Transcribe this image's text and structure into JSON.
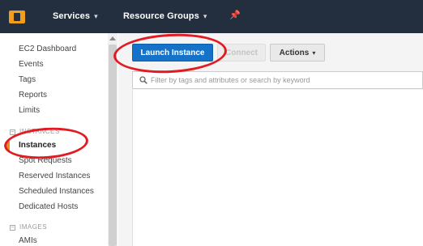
{
  "topnav": {
    "services_label": "Services",
    "resource_groups_label": "Resource Groups",
    "pin_icon": "pin-icon",
    "bg_color": "#232f3e",
    "logo_color": "#f29d1b"
  },
  "sidebar": {
    "items_top": [
      {
        "label": "EC2 Dashboard"
      },
      {
        "label": "Events"
      },
      {
        "label": "Tags"
      },
      {
        "label": "Reports"
      },
      {
        "label": "Limits"
      }
    ],
    "sections": [
      {
        "title": "INSTANCES",
        "items": [
          {
            "label": "Instances",
            "active": true
          },
          {
            "label": "Spot Requests"
          },
          {
            "label": "Reserved Instances"
          },
          {
            "label": "Scheduled Instances"
          },
          {
            "label": "Dedicated Hosts"
          }
        ]
      },
      {
        "title": "IMAGES",
        "items": [
          {
            "label": "AMIs"
          }
        ]
      }
    ],
    "active_color": "#e98b1f"
  },
  "toolbar": {
    "launch_label": "Launch Instance",
    "connect_label": "Connect",
    "actions_label": "Actions",
    "primary_color": "#1473c9"
  },
  "filter": {
    "placeholder": "Filter by tags and attributes or search by keyword",
    "icon": "search-icon"
  },
  "annotations": {
    "color": "#e11b22"
  }
}
